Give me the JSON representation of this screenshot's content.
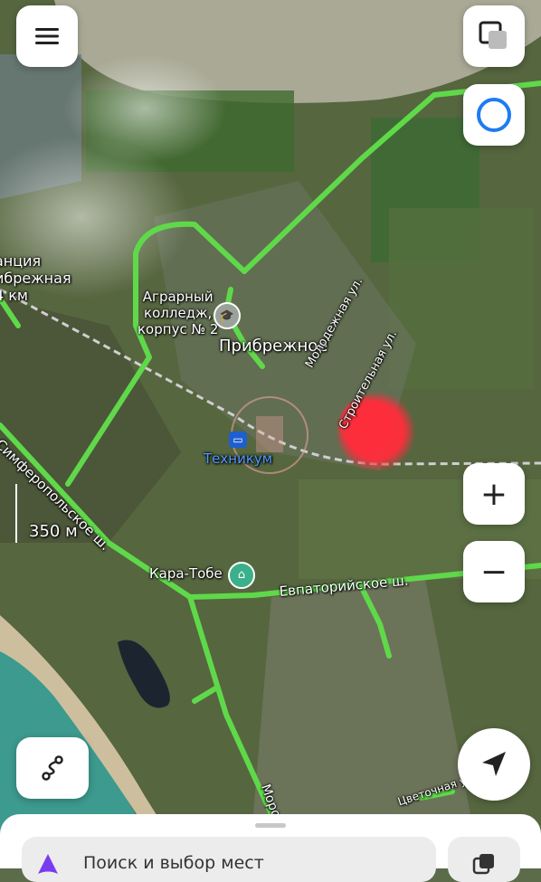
{
  "map": {
    "labels": {
      "station": [
        "анция",
        "ибрежная",
        "4 км"
      ],
      "college": [
        "Аграрный",
        "колледж,",
        "корпус № 2"
      ],
      "village": "Прибрежное",
      "technikum": "Техникум",
      "kara_tobe": "Кара-Тобе",
      "simferopol_road": "Симферопольское ш.",
      "evpatoria_road": "Евпаторийское ш.",
      "molodezhnaya": "Молодежная ул.",
      "stroitelnaya": "Строительная ул.",
      "tsvetochnaya": "Цветочная ул.",
      "morskaya": "Морс"
    },
    "scale": "350 м"
  },
  "controls": {
    "menu_icon": "menu-icon",
    "layers_icon": "layers-icon",
    "alice_icon": "alice-icon",
    "zoom_in": "+",
    "zoom_out": "−",
    "route_icon": "route-icon",
    "locate_icon": "navigation-arrow-icon"
  },
  "colors": {
    "road": "#5fd94a",
    "heatspot": "#ff2d3c",
    "alice": "#1e7cf2"
  },
  "search": {
    "placeholder": "Поиск и выбор мест"
  }
}
